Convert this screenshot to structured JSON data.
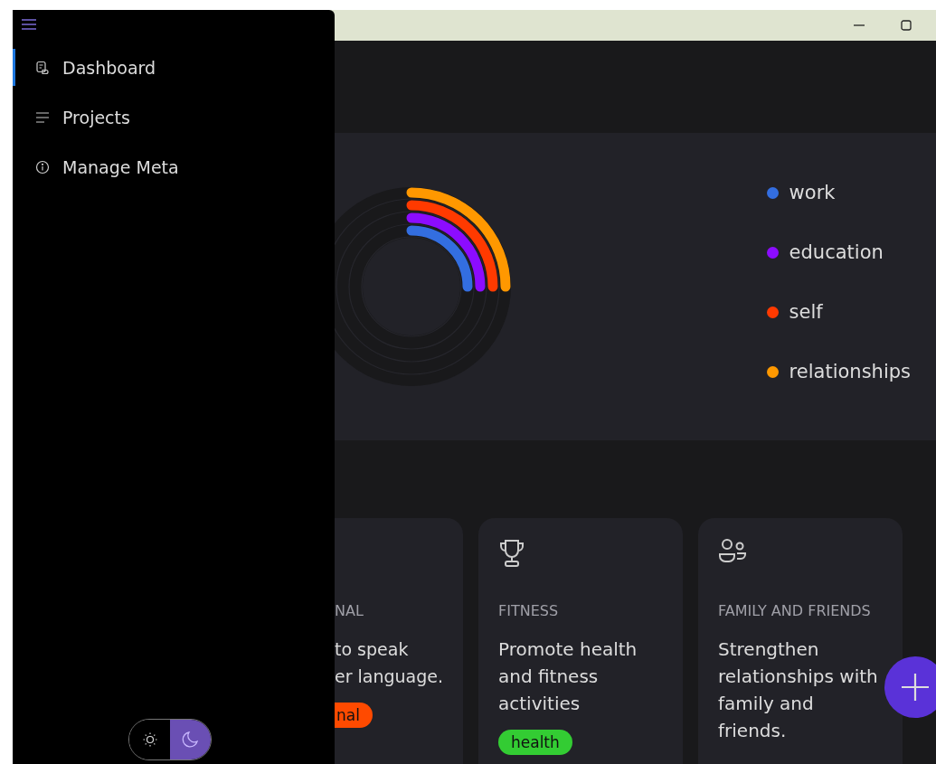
{
  "sidebar": {
    "items": [
      {
        "label": "Dashboard",
        "selected": true
      },
      {
        "label": "Projects",
        "selected": false
      },
      {
        "label": "Manage Meta",
        "selected": false
      }
    ],
    "theme_toggle": [
      {
        "selected": false
      },
      {
        "selected": true
      }
    ]
  },
  "chart_legend": [
    {
      "label": "work",
      "color": "#336ee0"
    },
    {
      "label": "education",
      "color": "#8c0cff"
    },
    {
      "label": "self",
      "color": "#ff3a00"
    },
    {
      "label": "relationships",
      "color": "#ff9800"
    }
  ],
  "goal_cards": [
    {
      "category": "NAL",
      "description": "to speak\ner language.",
      "tag": {
        "label": "nal",
        "color": "#ff4a00"
      }
    },
    {
      "category": "FITNESS",
      "description": "Promote health and fitness activities",
      "tag": {
        "label": "health",
        "color": "#33cc33"
      }
    },
    {
      "category": "FAMILY AND FRIENDS",
      "description": "Strengthen relationships with family and friends."
    }
  ]
}
